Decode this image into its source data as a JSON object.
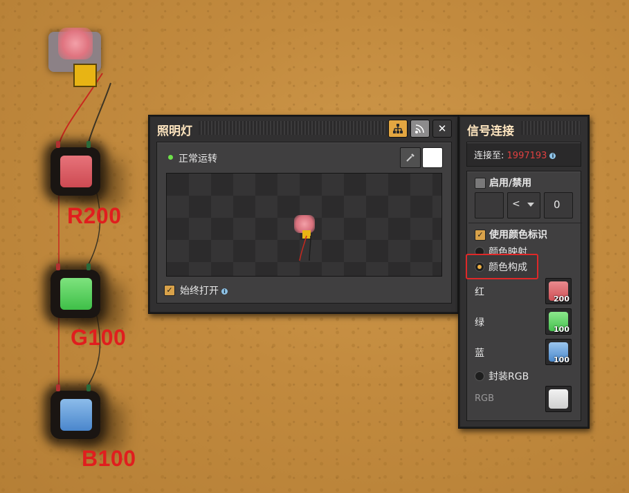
{
  "world": {
    "labels": {
      "red": "R200",
      "green": "G100",
      "blue": "B100"
    },
    "colors": {
      "red": "#dc5a5e",
      "green": "#58d458",
      "blue": "#6aa2de",
      "wire_red": "#c8281e",
      "wire_green": "#3c4a28"
    }
  },
  "lamp_panel": {
    "title": "照明灯",
    "status_text": "正常运转",
    "always_on_label": "始终打开",
    "always_on_checked": true
  },
  "signal_panel": {
    "title": "信号连接",
    "connected_to_label": "连接至:",
    "connected_network_id": "1997193",
    "enable_disable_label": "启用/禁用",
    "enable_disable_checked": false,
    "condition": {
      "operator": "<",
      "value": "0"
    },
    "use_colors_label": "使用颜色标识",
    "use_colors_checked": true,
    "color_mapping_label": "颜色映射",
    "color_components_label": "颜色构成",
    "selected_mode": "颜色构成",
    "channels": [
      {
        "label": "红",
        "value": "200",
        "color": "#d85a5c"
      },
      {
        "label": "绿",
        "value": "100",
        "color": "#58cf58"
      },
      {
        "label": "蓝",
        "value": "100",
        "color": "#5a98d6"
      }
    ],
    "packed_rgb_label": "封装RGB",
    "rgb_label": "RGB"
  }
}
